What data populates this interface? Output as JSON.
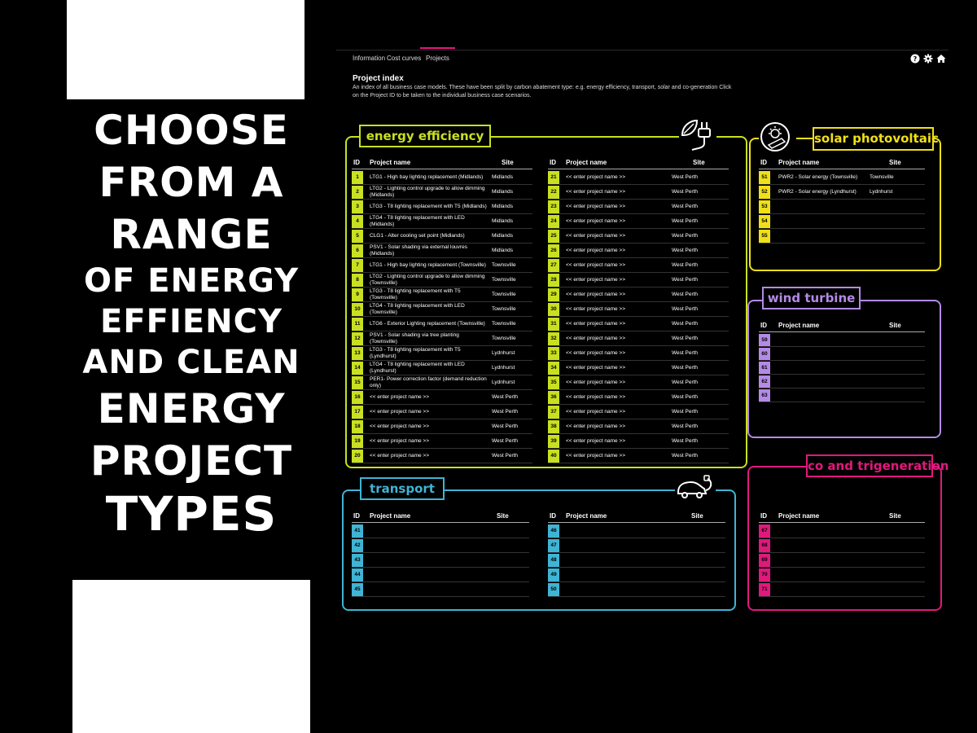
{
  "headline": [
    "CHOOSE",
    "FROM A",
    "RANGE",
    "OF ENERGY",
    "EFFIENCY",
    "AND CLEAN",
    "ENERGY",
    "PROJECT",
    "TYPES"
  ],
  "app": {
    "tabs": [
      {
        "label": "Information"
      },
      {
        "label": "Cost curves"
      },
      {
        "label": "Projects"
      }
    ],
    "active_tab": "Projects",
    "icons": [
      "help-icon",
      "gear-icon",
      "home-icon"
    ],
    "title": "Project index",
    "description": "An index of all business case models. These have been split by carbon abatement type: e.g. energy efficiency, transport, solar and co-generation Click on the Project ID to be taken to the individual business case scenarios.",
    "headers": {
      "id": "ID",
      "name": "Project name",
      "site": "Site"
    }
  },
  "colors": {
    "energy_efficiency": "#c8e020",
    "solar": "#f0e018",
    "wind": "#b48ae6",
    "transport": "#3fb4d4",
    "cogeneration": "#e0197d"
  },
  "panels": {
    "energy_efficiency": {
      "title": "energy efficiency",
      "icon": "plug-leaf-icon",
      "left": [
        {
          "id": "1",
          "name": "LTG1 - High bay lighting replacement (Midlands)",
          "site": "Midlands"
        },
        {
          "id": "2",
          "name": "LTG2 - Lighting control upgrade to allow dimming (Midlands)",
          "site": "Midlands"
        },
        {
          "id": "3",
          "name": "LTG3 - T8 lighting replacement with T5 (Midlands)",
          "site": "Midlands"
        },
        {
          "id": "4",
          "name": "LTG4 - T8 lighting replacement with LED (Midlands)",
          "site": "Midlands"
        },
        {
          "id": "5",
          "name": "CLG1 - Alter cooling set point (Midlands)",
          "site": "Midlands"
        },
        {
          "id": "6",
          "name": "PSV1 - Solar shading via external louvres (Midlands)",
          "site": "Midlands"
        },
        {
          "id": "7",
          "name": "LTG1 - High bay lighting replacement (Townsville)",
          "site": "Townsville"
        },
        {
          "id": "8",
          "name": "LTG2 - Lighting control upgrade to allow dimming (Townsville)",
          "site": "Townsville"
        },
        {
          "id": "9",
          "name": "LTG3 - T8 lighting replacement with T5 (Townsville)",
          "site": "Townsville"
        },
        {
          "id": "10",
          "name": "LTG4 - T8 lighting replacement with LED (Townsville)",
          "site": "Townsville"
        },
        {
          "id": "11",
          "name": "LTG6 - Exterior Lighting replacement (Townsville)",
          "site": "Townsville"
        },
        {
          "id": "12",
          "name": "PSV1 - Solar shading via tree planting (Townsville)",
          "site": "Townsville"
        },
        {
          "id": "13",
          "name": "LTG3 - T8 lighting replacement with T5 (Lyndhurst)",
          "site": "Lydnhurst"
        },
        {
          "id": "14",
          "name": "LTG4 - T8 lighting replacement with LED (Lyndhurst)",
          "site": "Lydnhurst"
        },
        {
          "id": "15",
          "name": "PER1- Power correction factor (demand reduction only)",
          "site": "Lydnhurst"
        },
        {
          "id": "16",
          "name": "<< enter project name >>",
          "site": "West Perth"
        },
        {
          "id": "17",
          "name": "<< enter project name >>",
          "site": "West Perth"
        },
        {
          "id": "18",
          "name": "<< enter project name >>",
          "site": "West Perth"
        },
        {
          "id": "19",
          "name": "<< enter project name >>",
          "site": "West Perth"
        },
        {
          "id": "20",
          "name": "<< enter project name >>",
          "site": "West Perth"
        }
      ],
      "right": [
        {
          "id": "21",
          "name": "<< enter project name >>",
          "site": "West Perth"
        },
        {
          "id": "22",
          "name": "<< enter project name >>",
          "site": "West Perth"
        },
        {
          "id": "23",
          "name": "<< enter project name >>",
          "site": "West Perth"
        },
        {
          "id": "24",
          "name": "<< enter project name >>",
          "site": "West Perth"
        },
        {
          "id": "25",
          "name": "<< enter project name >>",
          "site": "West Perth"
        },
        {
          "id": "26",
          "name": "<< enter project name >>",
          "site": "West Perth"
        },
        {
          "id": "27",
          "name": "<< enter project name >>",
          "site": "West Perth"
        },
        {
          "id": "28",
          "name": "<< enter project name >>",
          "site": "West Perth"
        },
        {
          "id": "29",
          "name": "<< enter project name >>",
          "site": "West Perth"
        },
        {
          "id": "30",
          "name": "<< enter project name >>",
          "site": "West Perth"
        },
        {
          "id": "31",
          "name": "<< enter project name >>",
          "site": "West Perth"
        },
        {
          "id": "32",
          "name": "<< enter project name >>",
          "site": "West Perth"
        },
        {
          "id": "33",
          "name": "<< enter project name >>",
          "site": "West Perth"
        },
        {
          "id": "34",
          "name": "<< enter project name >>",
          "site": "West Perth"
        },
        {
          "id": "35",
          "name": "<< enter project name >>",
          "site": "West Perth"
        },
        {
          "id": "36",
          "name": "<< enter project name >>",
          "site": "West Perth"
        },
        {
          "id": "37",
          "name": "<< enter project name >>",
          "site": "West Perth"
        },
        {
          "id": "38",
          "name": "<< enter project name >>",
          "site": "West Perth"
        },
        {
          "id": "39",
          "name": "<< enter project name >>",
          "site": "West Perth"
        },
        {
          "id": "40",
          "name": "<< enter project name >>",
          "site": "West Perth"
        }
      ]
    },
    "solar": {
      "title": "solar photovoltaic",
      "icon": "sun-icon",
      "rows": [
        {
          "id": "51",
          "name": "PWR2 - Solar energy (Townsville)",
          "site": "Townsville"
        },
        {
          "id": "52",
          "name": "PWR2 - Solar energy (Lyndhurst)",
          "site": "Lydnhurst"
        },
        {
          "id": "53",
          "name": "",
          "site": ""
        },
        {
          "id": "54",
          "name": "",
          "site": ""
        },
        {
          "id": "55",
          "name": "",
          "site": ""
        }
      ]
    },
    "wind": {
      "title": "wind turbine",
      "rows": [
        {
          "id": "59",
          "name": "",
          "site": ""
        },
        {
          "id": "60",
          "name": "",
          "site": ""
        },
        {
          "id": "61",
          "name": "",
          "site": ""
        },
        {
          "id": "62",
          "name": "",
          "site": ""
        },
        {
          "id": "63",
          "name": "",
          "site": ""
        }
      ]
    },
    "transport": {
      "title": "transport",
      "icon": "electric-car-icon",
      "left": [
        {
          "id": "41",
          "name": "",
          "site": ""
        },
        {
          "id": "42",
          "name": "",
          "site": ""
        },
        {
          "id": "43",
          "name": "",
          "site": ""
        },
        {
          "id": "44",
          "name": "",
          "site": ""
        },
        {
          "id": "45",
          "name": "",
          "site": ""
        }
      ],
      "right": [
        {
          "id": "46",
          "name": "",
          "site": ""
        },
        {
          "id": "47",
          "name": "",
          "site": ""
        },
        {
          "id": "48",
          "name": "",
          "site": ""
        },
        {
          "id": "49",
          "name": "",
          "site": ""
        },
        {
          "id": "50",
          "name": "",
          "site": ""
        }
      ]
    },
    "cogeneration": {
      "title": "co and trigeneration",
      "rows": [
        {
          "id": "67",
          "name": "",
          "site": ""
        },
        {
          "id": "68",
          "name": "",
          "site": ""
        },
        {
          "id": "69",
          "name": "",
          "site": ""
        },
        {
          "id": "70",
          "name": "",
          "site": ""
        },
        {
          "id": "71",
          "name": "",
          "site": ""
        }
      ]
    }
  }
}
